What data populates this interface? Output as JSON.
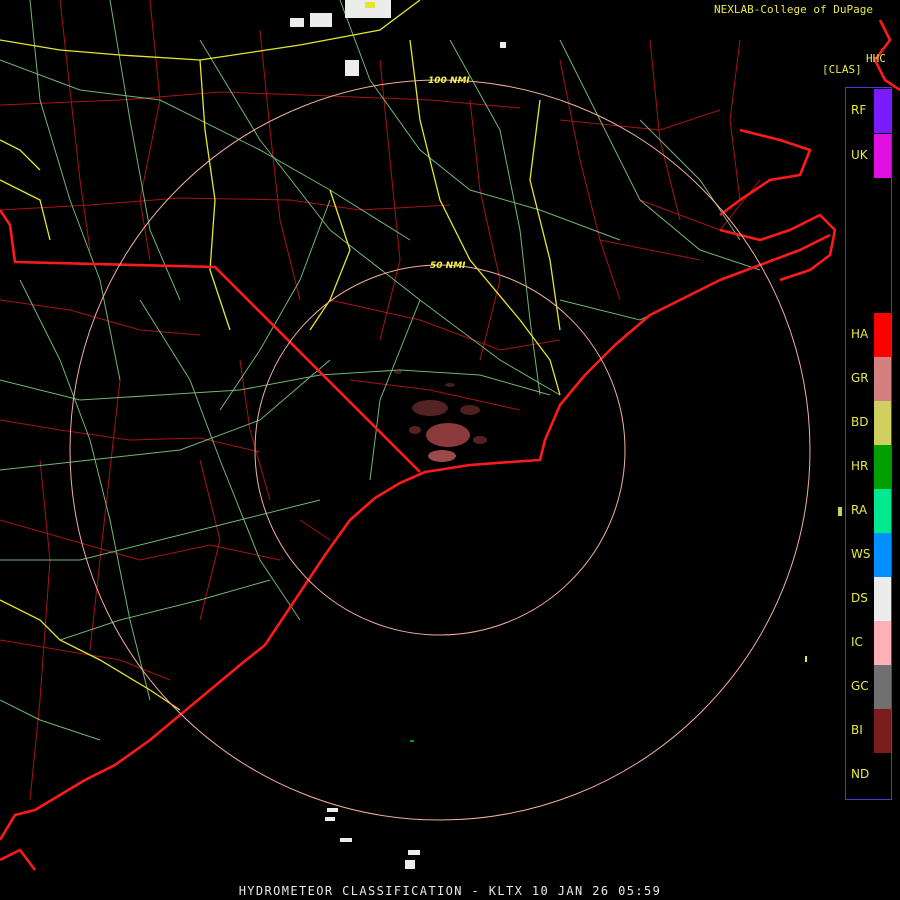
{
  "header": {
    "credit": "NEXLAB-College of DuPage",
    "product_code": "HHC",
    "product_mode": "[CLAS]"
  },
  "range_rings": [
    {
      "label": "100 NMI"
    },
    {
      "label": "50 NMI"
    }
  ],
  "legend": {
    "categories": [
      {
        "code": "RF",
        "color": "#7a1aff"
      },
      {
        "code": "UK",
        "color": "#e010e0"
      },
      {
        "code": "HA",
        "color": "#ff0000"
      },
      {
        "code": "GR",
        "color": "#d48080"
      },
      {
        "code": "BD",
        "color": "#d0d060"
      },
      {
        "code": "HR",
        "color": "#00a000"
      },
      {
        "code": "RA",
        "color": "#00e890"
      },
      {
        "code": "WS",
        "color": "#0090ff"
      },
      {
        "code": "DS",
        "color": "#ececec"
      },
      {
        "code": "IC",
        "color": "#ffb0b8"
      },
      {
        "code": "GC",
        "color": "#707070"
      },
      {
        "code": "BI",
        "color": "#7a1c1c"
      },
      {
        "code": "ND",
        "color": "#000000"
      }
    ]
  },
  "footer": {
    "title": "HYDROMETEOR CLASSIFICATION - KLTX 10 JAN 26 05:59"
  },
  "colors": {
    "coast_state": "#ff1a1a",
    "county": "#b81818",
    "highway": "#e8e830",
    "road": "#90e090",
    "range_ring": "#f2b0a0",
    "biological_echo": "#8a3a3a"
  }
}
